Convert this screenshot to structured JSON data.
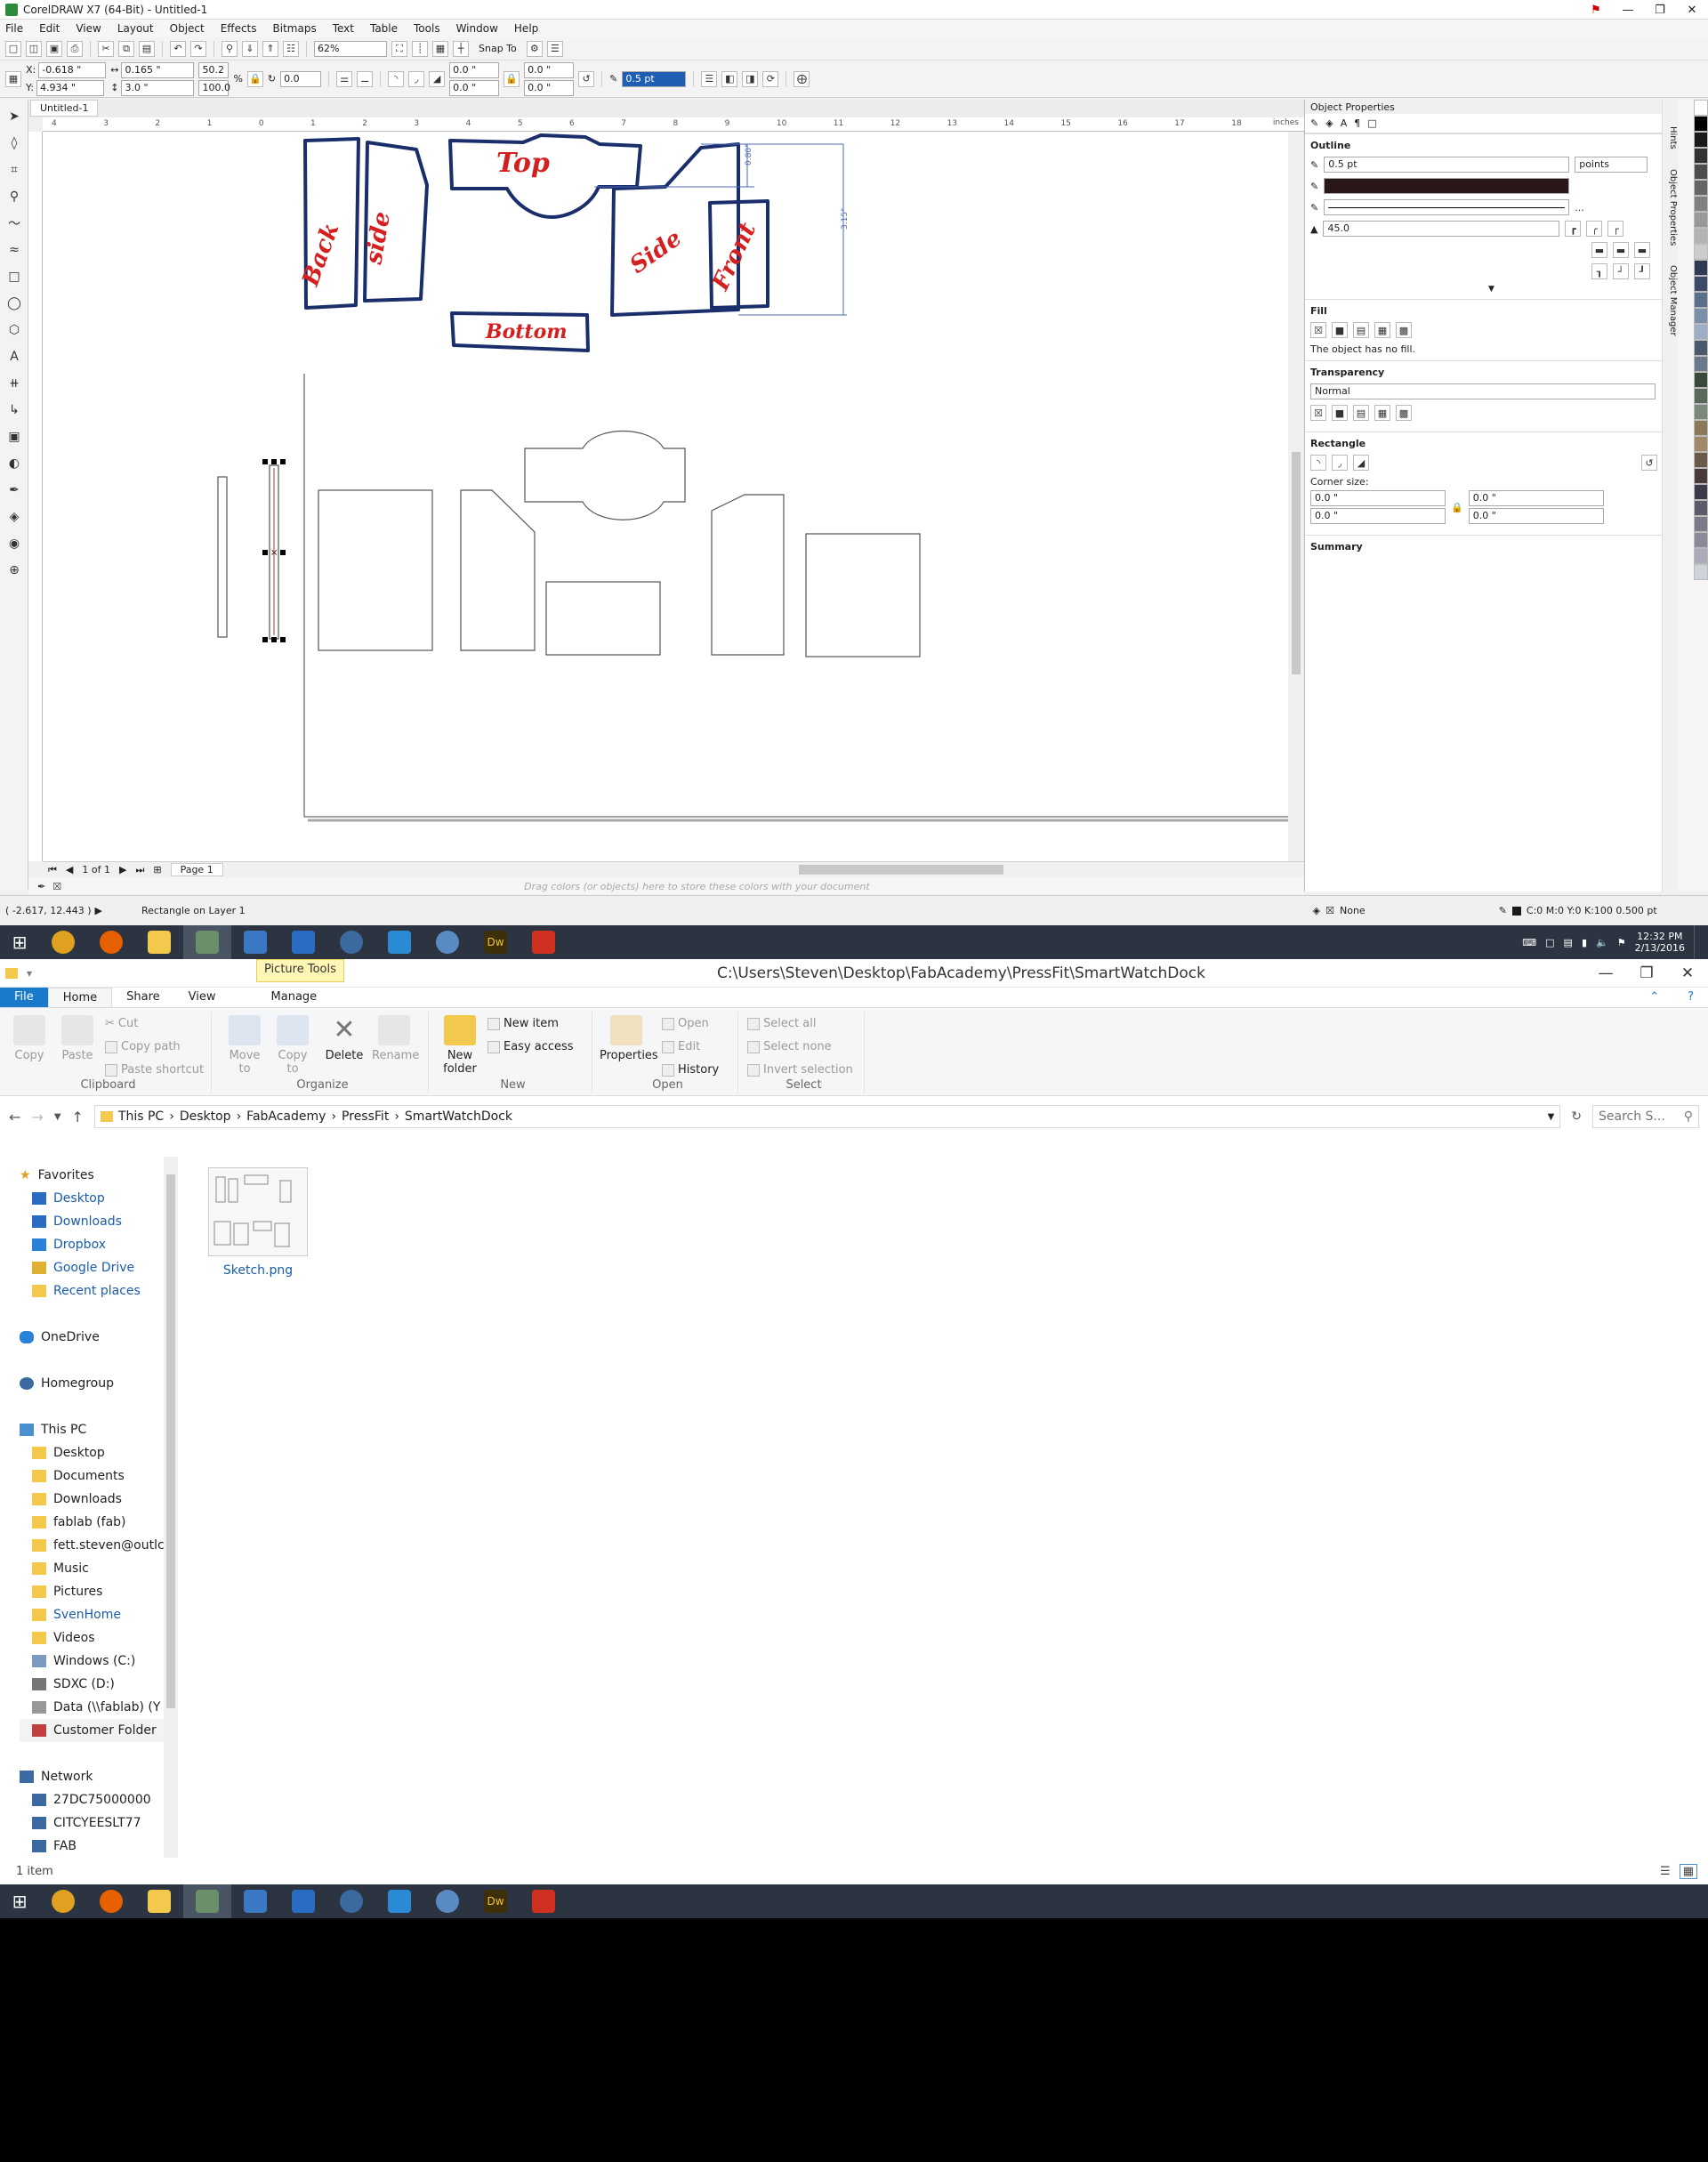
{
  "corel": {
    "title": "CorelDRAW X7 (64-Bit) - Untitled-1",
    "menu": [
      "File",
      "Edit",
      "View",
      "Layout",
      "Object",
      "Effects",
      "Bitmaps",
      "Text",
      "Table",
      "Tools",
      "Window",
      "Help"
    ],
    "toolbar": {
      "zoom": "62%",
      "snap_to": "Snap To"
    },
    "propbar": {
      "x": "-0.618 \"",
      "y": "4.934 \"",
      "w": "0.165 \"",
      "h": "3.0 \"",
      "scale_w": "50.2",
      "scale_h": "100.0",
      "pct": "%",
      "rotation": "0.0",
      "corner1": "0.0 \"",
      "corner2": "0.0 \"",
      "corner3": "0.0 \"",
      "corner4": "0.0 \"",
      "outline_width": "0.5 pt"
    },
    "doc_tab": "Untitled-1",
    "ruler_unit": "inches",
    "ruler_ticks": [
      "4",
      "3",
      "2",
      "1",
      "0",
      "1",
      "2",
      "3",
      "4",
      "5",
      "6",
      "7",
      "8",
      "9",
      "10",
      "11",
      "12",
      "13",
      "14",
      "15",
      "16",
      "17",
      "18"
    ],
    "sketch_labels": {
      "back": "Back",
      "side1": "side",
      "top": "Top",
      "side2": "Side",
      "front": "Front",
      "bottom": "Bottom"
    },
    "dims": {
      "small": "0.80\"",
      "large": "3.15\""
    },
    "page_nav": {
      "page_count": "1 of 1",
      "page_tab": "Page 1"
    },
    "color_hint": "Drag colors (or objects) here to store these colors with your document",
    "status": {
      "coords": "( -2.617, 12.443 )",
      "object": "Rectangle on Layer 1",
      "fill": "None",
      "outline": "C:0 M:0 Y:0 K:100  0.500 pt"
    },
    "docker": {
      "title": "Object Properties",
      "outline_label": "Outline",
      "outline_width": "0.5 pt",
      "outline_units": "points",
      "miter": "45.0",
      "ellipsis": "...",
      "fill_label": "Fill",
      "fill_note": "The object has no fill.",
      "transparency_label": "Transparency",
      "transparency_mode": "Normal",
      "rectangle_label": "Rectangle",
      "corner_size_label": "Corner size:",
      "corner_values": [
        "0.0 \"",
        "0.0 \"",
        "0.0 \"",
        "0.0 \""
      ],
      "summary_label": "Summary",
      "side_tabs": [
        "Hints",
        "Object Properties",
        "Object Manager"
      ]
    },
    "palette_colors": [
      "#ffffff",
      "#000000",
      "#1a1a1a",
      "#333333",
      "#4d4d4d",
      "#666666",
      "#808080",
      "#999999",
      "#b3b3b3",
      "#cccccc",
      "#2e3a52",
      "#3c4a66",
      "#5a6f8c",
      "#7b8fab",
      "#9caec5",
      "#4a5a6a",
      "#6a7a8a",
      "#3a4a3a",
      "#5a6a5a",
      "#7a8a7a",
      "#8a7a5a",
      "#a08a6a",
      "#6a5a4a",
      "#4a3a3a",
      "#3a3a4a",
      "#5a5a6a",
      "#7a7a8a",
      "#8a8a9a",
      "#aaaabb",
      "#cfd3da"
    ]
  },
  "taskbar": {
    "apps": [
      {
        "name": "chrome",
        "color": "#e0a020"
      },
      {
        "name": "firefox",
        "color": "#e66000"
      },
      {
        "name": "file-explorer",
        "color": "#f2c94c"
      },
      {
        "name": "coreldraw",
        "color": "#6b8e6b"
      },
      {
        "name": "remote-desktop",
        "color": "#3b78c4"
      },
      {
        "name": "outlook",
        "color": "#2a6cc4"
      },
      {
        "name": "browser",
        "color": "#3a6aa0"
      },
      {
        "name": "connect",
        "color": "#2a8ad4"
      },
      {
        "name": "backup",
        "color": "#5a8ac4"
      },
      {
        "name": "dreamweaver",
        "color": "#3d2f0a"
      },
      {
        "name": "sketchup",
        "color": "#d03020"
      }
    ],
    "dreamweaver_label": "Dw",
    "time": "12:32 PM",
    "date": "2/13/2016"
  },
  "explorer": {
    "title": "C:\\Users\\Steven\\Desktop\\FabAcademy\\PressFit\\SmartWatchDock",
    "picture_tools": "Picture Tools",
    "tabs": [
      "File",
      "Home",
      "Share",
      "View",
      "Manage"
    ],
    "ribbon": {
      "copy": "Copy",
      "paste": "Paste",
      "cut": "Cut",
      "copy_path": "Copy path",
      "paste_shortcut": "Paste shortcut",
      "clipboard": "Clipboard",
      "move_to": "Move to",
      "copy_to": "Copy to",
      "delete": "Delete",
      "rename": "Rename",
      "organize": "Organize",
      "new_folder": "New folder",
      "new_item": "New item",
      "easy_access": "Easy access",
      "new": "New",
      "properties": "Properties",
      "open": "Open",
      "edit": "Edit",
      "history": "History",
      "open_group": "Open",
      "select_all": "Select all",
      "select_none": "Select none",
      "invert_selection": "Invert selection",
      "select": "Select"
    },
    "breadcrumb": [
      "This PC",
      "Desktop",
      "FabAcademy",
      "PressFit",
      "SmartWatchDock"
    ],
    "search_placeholder": "Search S...",
    "nav": {
      "favorites": "Favorites",
      "fav_items": [
        "Desktop",
        "Downloads",
        "Dropbox",
        "Google Drive",
        "Recent places"
      ],
      "onedrive": "OneDrive",
      "homegroup": "Homegroup",
      "thispc": "This PC",
      "pc_items": [
        "Desktop",
        "Documents",
        "Downloads",
        "fablab (fab)",
        "fett.steven@outlc",
        "Music",
        "Pictures",
        "SvenHome",
        "Videos",
        "Windows (C:)",
        "SDXC (D:)",
        "Data (\\\\fablab) (Y",
        "Customer Folder"
      ],
      "network": "Network",
      "net_items": [
        "27DC75000000",
        "CITCYEESLT77",
        "FAB"
      ]
    },
    "file": {
      "name": "Sketch.png"
    },
    "status": "1 item"
  }
}
